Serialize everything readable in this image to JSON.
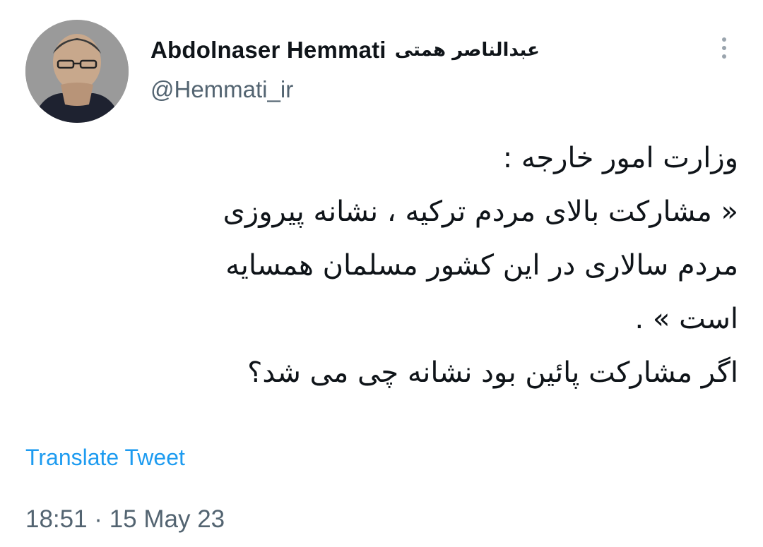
{
  "author": {
    "display_name": "Abdolnaser Hemmati",
    "display_name_fa": "عبدالناصر همتی",
    "handle": "@Hemmati_ir",
    "avatar_icon": "user-avatar-photo"
  },
  "menu": {
    "icon": "more-vertical-icon"
  },
  "tweet": {
    "lines": [
      "وزارت امور خارجه :",
      "« مشارکت بالای مردم ترکیه ، نشانه پیروزی",
      "مردم سالاری در این کشور مسلمان همسایه",
      "است » .",
      "اگر مشارکت پائین بود نشانه چی می شد؟"
    ]
  },
  "translate_label": "Translate Tweet",
  "timestamp": "18:51 · 15 May 23",
  "colors": {
    "link": "#1d9bf0",
    "secondary_text": "#536471",
    "primary_text": "#0f1419"
  }
}
